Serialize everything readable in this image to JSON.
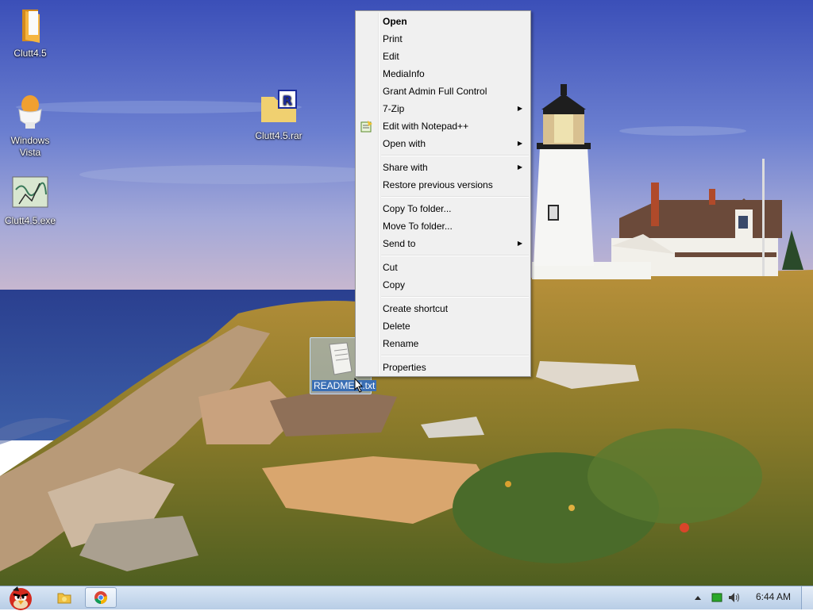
{
  "desktop_icons": [
    {
      "label": "Clutt4.5",
      "icon": "folder-icon"
    },
    {
      "label": "Windows Vista",
      "icon": "egg-cup-icon"
    },
    {
      "label": "Clutt4.5.exe",
      "icon": "map-exe-icon"
    },
    {
      "label": "Clutt4.5.rar",
      "icon": "rar-archive-icon"
    }
  ],
  "selected_file": {
    "label": "README!!!.txt",
    "icon": "text-document-icon"
  },
  "context_menu": {
    "items": [
      {
        "label": "Open",
        "bold": true
      },
      {
        "label": "Print"
      },
      {
        "label": "Edit"
      },
      {
        "label": "MediaInfo"
      },
      {
        "label": "Grant Admin Full Control"
      },
      {
        "label": "7-Zip",
        "submenu": true
      },
      {
        "label": "Edit with Notepad++",
        "icon": "notepad-plus-plus-icon"
      },
      {
        "label": "Open with",
        "submenu": true
      },
      {
        "separator": true
      },
      {
        "label": "Share with",
        "submenu": true
      },
      {
        "label": "Restore previous versions"
      },
      {
        "separator": true
      },
      {
        "label": "Copy To folder..."
      },
      {
        "label": "Move To folder..."
      },
      {
        "label": "Send to",
        "submenu": true
      },
      {
        "separator": true
      },
      {
        "label": "Cut"
      },
      {
        "label": "Copy"
      },
      {
        "separator": true
      },
      {
        "label": "Create shortcut"
      },
      {
        "label": "Delete"
      },
      {
        "label": "Rename"
      },
      {
        "separator": true
      },
      {
        "label": "Properties"
      }
    ]
  },
  "taskbar": {
    "start_icon": "angry-bird-start-icon",
    "pinned": [
      {
        "name": "windows-explorer",
        "icon": "folder-icon"
      },
      {
        "name": "google-chrome",
        "icon": "chrome-icon",
        "active": true
      }
    ],
    "tray_icons": [
      "show-hidden-icons-arrow-icon",
      "battery-icon",
      "volume-icon"
    ],
    "clock": "6:44 AM"
  },
  "colors": {
    "menu_background": "#f0f0f0",
    "taskbar_top": "#d9e6f5",
    "taskbar_bottom": "#b8cde6",
    "selection": "#3a6fb5"
  }
}
